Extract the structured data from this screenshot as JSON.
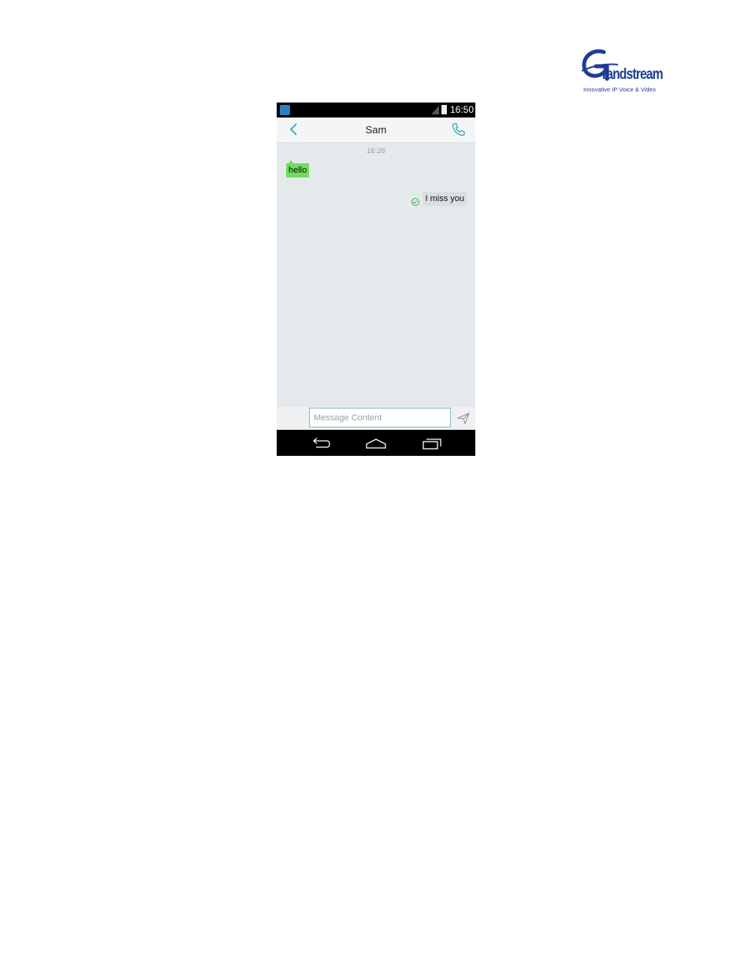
{
  "logo": {
    "wordmark": "randstream",
    "tagline": "Innovative IP Voice & Video"
  },
  "status_bar": {
    "time": "16:50",
    "icons": [
      "app-icon",
      "signal-icon",
      "battery-icon"
    ]
  },
  "header": {
    "contact_name": "Sam",
    "back_icon": "back-icon",
    "call_icon": "call-icon"
  },
  "conversation": {
    "timestamp": "16:26",
    "messages": [
      {
        "direction": "incoming",
        "text": "hello",
        "color": "#6edc5c"
      },
      {
        "direction": "outgoing",
        "text": "I miss you",
        "status_icon": "sent-check-icon"
      }
    ]
  },
  "composer": {
    "placeholder": "Message Content",
    "value": "",
    "send_icon": "send-icon"
  },
  "nav_bar": {
    "icons": [
      "back-icon",
      "home-icon",
      "recents-icon"
    ]
  },
  "colors": {
    "accent": "#2aa3b0",
    "incoming_bubble": "#6edc5c",
    "outgoing_bubble": "#dcdfe2",
    "brand": "#1f3c95"
  }
}
